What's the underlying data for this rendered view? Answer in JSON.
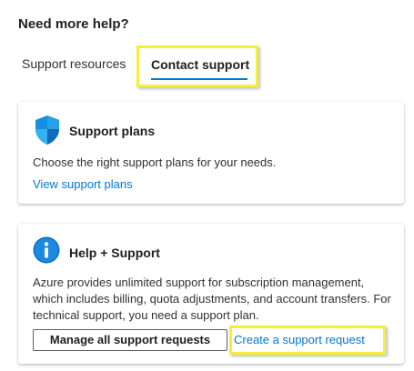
{
  "header": {
    "title": "Need more help?"
  },
  "tabs": [
    {
      "label": "Support resources",
      "selected": false
    },
    {
      "label": "Contact support",
      "selected": true
    }
  ],
  "cards": {
    "plans": {
      "icon": "shield-icon",
      "title": "Support plans",
      "description": "Choose the right support plans for your needs.",
      "link_label": "View support plans"
    },
    "help": {
      "icon": "info-icon",
      "title": "Help + Support",
      "description": "Azure provides unlimited support for subscription management, which includes billing, quota adjustments, and account transfers. For technical support, you need a support plan.",
      "button_label": "Manage all support requests",
      "link_label": "Create a support request"
    }
  },
  "colors": {
    "accent": "#0078d4",
    "highlight": "#f5f035",
    "text": "#323130"
  }
}
